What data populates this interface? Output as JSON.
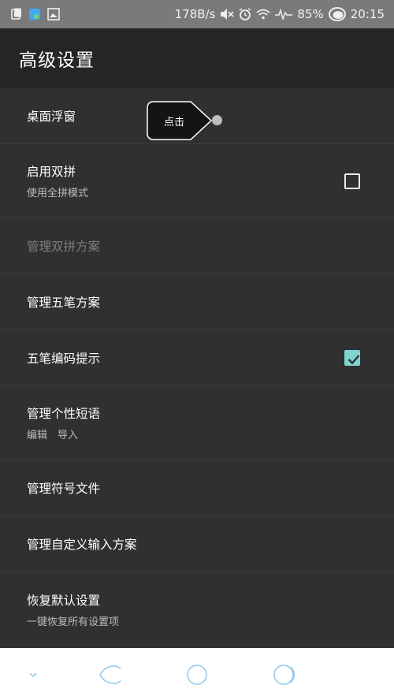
{
  "status_bar": {
    "speed": "178B/s",
    "battery": "85%",
    "time": "20:15",
    "icons_left": [
      "clipboard-icon",
      "app-icon",
      "image-icon"
    ],
    "icons_right": [
      "mute-icon",
      "alarm-icon",
      "wifi-icon",
      "signal-icon",
      "battery-icon"
    ]
  },
  "app_bar": {
    "title": "高级设置"
  },
  "tooltip": {
    "label": "点击"
  },
  "settings": {
    "floating_window": {
      "title": "桌面浮窗"
    },
    "enable_shuangpin": {
      "title": "启用双拼",
      "subtitle": "使用全拼模式",
      "checked": false
    },
    "manage_shuangpin": {
      "title": "管理双拼方案",
      "disabled": true
    },
    "manage_wubi": {
      "title": "管理五笔方案"
    },
    "wubi_hint": {
      "title": "五笔编码提示",
      "checked": true
    },
    "manage_phrases": {
      "title": "管理个性短语",
      "subtitle": "编辑　导入"
    },
    "manage_symbols": {
      "title": "管理符号文件"
    },
    "manage_custom_input": {
      "title": "管理自定义输入方案"
    },
    "restore_defaults": {
      "title": "恢复默认设置",
      "subtitle": "一键恢复所有设置项"
    }
  },
  "nav_bar": {
    "buttons": [
      "hide-keyboard-icon",
      "back-icon",
      "home-icon",
      "recents-icon"
    ]
  },
  "colors": {
    "accent": "#7fd3cf",
    "background": "#303030",
    "app_bar": "#252525",
    "status_bar": "#7a7a7a"
  }
}
